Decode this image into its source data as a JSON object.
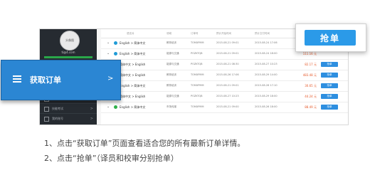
{
  "sidebar": {
    "avatar_text": "头像图",
    "email": "ti@4.com",
    "items": [
      {
        "label": "",
        "icon": "doc-icon"
      },
      {
        "label": "",
        "icon": "doc-icon"
      },
      {
        "label": "技能考试",
        "icon": "edit-icon"
      },
      {
        "label": "我的账号",
        "icon": "user-icon"
      }
    ]
  },
  "table": {
    "headers": [
      "语言对",
      "领域",
      "订单号",
      "预计开始时间",
      "预计交付时间"
    ],
    "rows": [
      {
        "lang": "English > 简体中文",
        "field": "教育培训",
        "order": "TOMXPMM",
        "start": "2015-08-21 09:01",
        "end": "2015-08-24 17:06",
        "price": "",
        "icon_color": "#1f9bd7"
      },
      {
        "lang": "English > 简体中文",
        "field": "能源与交通",
        "order": "POZKTQB",
        "start": "2015-08-21 09:01",
        "end": "2015-08-24 18:00",
        "price": "111.16 元",
        "icon_color": "#1f9bd7"
      },
      {
        "lang": "简体中文 > English",
        "field": "能源与交通",
        "order": "POZKTQB",
        "start": "2015-08-21 08:30",
        "end": "2015-08-27 10:23",
        "price": "82.17 元",
        "icon_color": "#2fb04a"
      },
      {
        "lang": "简体中文 > English",
        "field": "教育培训",
        "order": "TOMXPMM",
        "start": "2015-08-26 17:06",
        "end": "2015-08-29 14:00",
        "price": "483.48 元",
        "icon_color": "#2fb04a"
      },
      {
        "lang": "English > 简体中文",
        "field": "教育培训",
        "order": "TOMXPMM",
        "start": "2015-08-21 09:01",
        "end": "2015-08-26 17:10",
        "price": "30.65 元",
        "icon_color": "#1f9bd7"
      },
      {
        "lang": "简体中文 > English",
        "field": "能源与交通",
        "order": "POZKTQB",
        "start": "2015-08-27 10:23",
        "end": "2015-08-29 18:00",
        "price": "44.24 元",
        "icon_color": "#2fb04a"
      },
      {
        "lang": "English > 简体中文",
        "field": "市场传媒",
        "order": "TOMXPMM",
        "start": "2015-08-21 09:00",
        "end": "2015-08-26 18:00",
        "price": "88.49 元",
        "icon_color": "#2fb04a"
      }
    ],
    "grab_label": "抢单"
  },
  "get_orders": {
    "label": "获取订单",
    "arrow": ">"
  },
  "grab_button": {
    "label": "抢单"
  },
  "instructions": {
    "line1": "1、点击“获取订单”页面查看适合您的所有最新订单详情。",
    "line2": "2、点击“抢单”（译员和校审分别抢单）"
  },
  "colors": {
    "sidebar": "#262b31",
    "accent_blue": "#2b86d3",
    "grab_blue": "#2b9ae8",
    "price": "#e65a2c"
  }
}
